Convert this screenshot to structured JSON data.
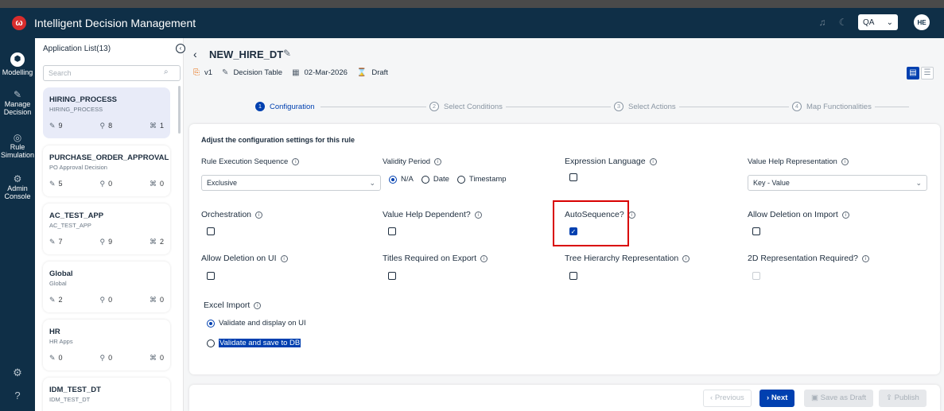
{
  "header": {
    "logo_text": "ω",
    "app_title": "Intelligent Decision Management",
    "bell_icon": "bell-icon",
    "theme_icon": "moon-icon",
    "env_selected": "QA",
    "env_chevron": "⌄",
    "user_initials": "HE"
  },
  "nav": {
    "items": [
      {
        "label": "Modelling",
        "icon": "⬢"
      },
      {
        "label": "Manage Decision",
        "icon": "✎"
      },
      {
        "label": "Rule Simulation",
        "icon": "◎"
      },
      {
        "label": "Admin Console",
        "icon": "⚙"
      }
    ],
    "settings_icon": "⚙",
    "help_icon": "?"
  },
  "sidebar": {
    "title": "Application List(13)",
    "search_placeholder": "Search",
    "apps": [
      {
        "name": "HIRING_PROCESS",
        "sub": "HIRING_PROCESS",
        "stats": [
          "9",
          "8",
          "1"
        ]
      },
      {
        "name": "PURCHASE_ORDER_APPROVAL",
        "sub": "PO Approval Decision",
        "stats": [
          "5",
          "0",
          "0"
        ]
      },
      {
        "name": "AC_TEST_APP",
        "sub": "AC_TEST_APP",
        "stats": [
          "7",
          "9",
          "2"
        ]
      },
      {
        "name": "Global",
        "sub": "Global",
        "stats": [
          "2",
          "0",
          "0"
        ]
      },
      {
        "name": "HR",
        "sub": "HR Apps",
        "stats": [
          "0",
          "0",
          "0"
        ]
      },
      {
        "name": "IDM_TEST_DT",
        "sub": "IDM_TEST_DT",
        "stats": [
          "",
          "",
          ""
        ]
      }
    ]
  },
  "rule": {
    "title": "NEW_HIRE_DT",
    "version": "v1",
    "type": "Decision Table",
    "date": "02-Mar-2026",
    "status": "Draft"
  },
  "steps": [
    {
      "num": "1",
      "label": "Configuration"
    },
    {
      "num": "2",
      "label": "Select Conditions"
    },
    {
      "num": "3",
      "label": "Select Actions"
    },
    {
      "num": "4",
      "label": "Map Functionalities"
    }
  ],
  "config": {
    "heading": "Adjust the configuration settings for this rule",
    "rule_execution_sequence": {
      "label": "Rule Execution Sequence",
      "value": "Exclusive"
    },
    "validity_period": {
      "label": "Validity Period",
      "options": [
        "N/A",
        "Date",
        "Timestamp"
      ],
      "selected": "N/A"
    },
    "expression_language": {
      "label": "Expression Language",
      "checked": false
    },
    "value_help_representation": {
      "label": "Value Help Representation",
      "value": "Key - Value"
    },
    "orchestration": {
      "label": "Orchestration",
      "checked": false
    },
    "value_help_dependent": {
      "label": "Value Help Dependent?",
      "checked": false
    },
    "auto_sequence": {
      "label": "AutoSequence?",
      "checked": true
    },
    "allow_deletion_import": {
      "label": "Allow Deletion on Import",
      "checked": false
    },
    "allow_deletion_ui": {
      "label": "Allow Deletion on UI",
      "checked": false
    },
    "titles_required_export": {
      "label": "Titles Required on Export",
      "checked": false
    },
    "tree_hierarchy": {
      "label": "Tree Hierarchy Representation",
      "checked": false
    },
    "representation_2d": {
      "label": "2D Representation Required?",
      "checked": false,
      "disabled": true
    },
    "excel_import": {
      "label": "Excel Import",
      "options": [
        "Validate and display on UI",
        "Validate and save to DB"
      ],
      "selected": "Validate and display on UI"
    }
  },
  "footer": {
    "previous": "Previous",
    "next": "Next",
    "save_draft": "Save as Draft",
    "publish": "Publish"
  },
  "colors": {
    "nav_bg": "#0f2f47",
    "primary": "#0040b0",
    "highlight": "#d90000"
  }
}
